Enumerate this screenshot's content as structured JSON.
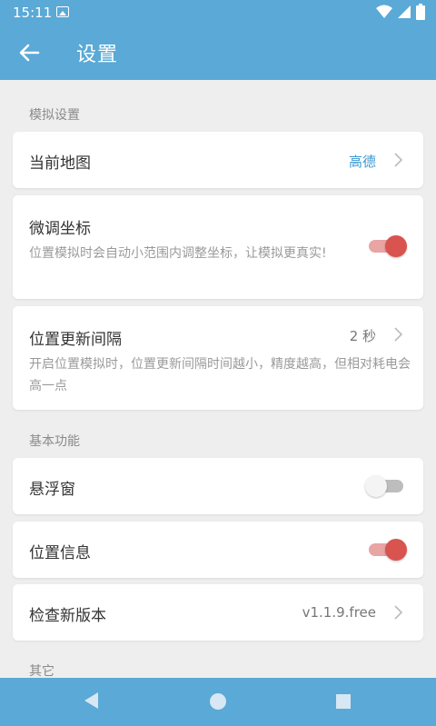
{
  "statusbar": {
    "time": "15:11"
  },
  "appbar": {
    "title": "设置"
  },
  "sections": {
    "simulation": "模拟设置",
    "basic": "基本功能",
    "other": "其它"
  },
  "items": {
    "current_map": {
      "title": "当前地图",
      "value": "高德"
    },
    "fine_tune": {
      "title": "微调坐标",
      "desc": "位置模拟时会自动小范围内调整坐标，让模拟更真实!",
      "enabled": true
    },
    "update_interval": {
      "title": "位置更新间隔",
      "value": "2 秒",
      "desc": "开启位置模拟时，位置更新间隔时间越小，精度越高，但相对耗电会高一点"
    },
    "floating_window": {
      "title": "悬浮窗",
      "enabled": false
    },
    "location_info": {
      "title": "位置信息",
      "enabled": true
    },
    "check_update": {
      "title": "检查新版本",
      "value": "v1.1.9.free"
    }
  },
  "colors": {
    "primary": "#5aa9d6",
    "toggle_on": "#d9534f",
    "accent_text": "#3a97d1"
  }
}
